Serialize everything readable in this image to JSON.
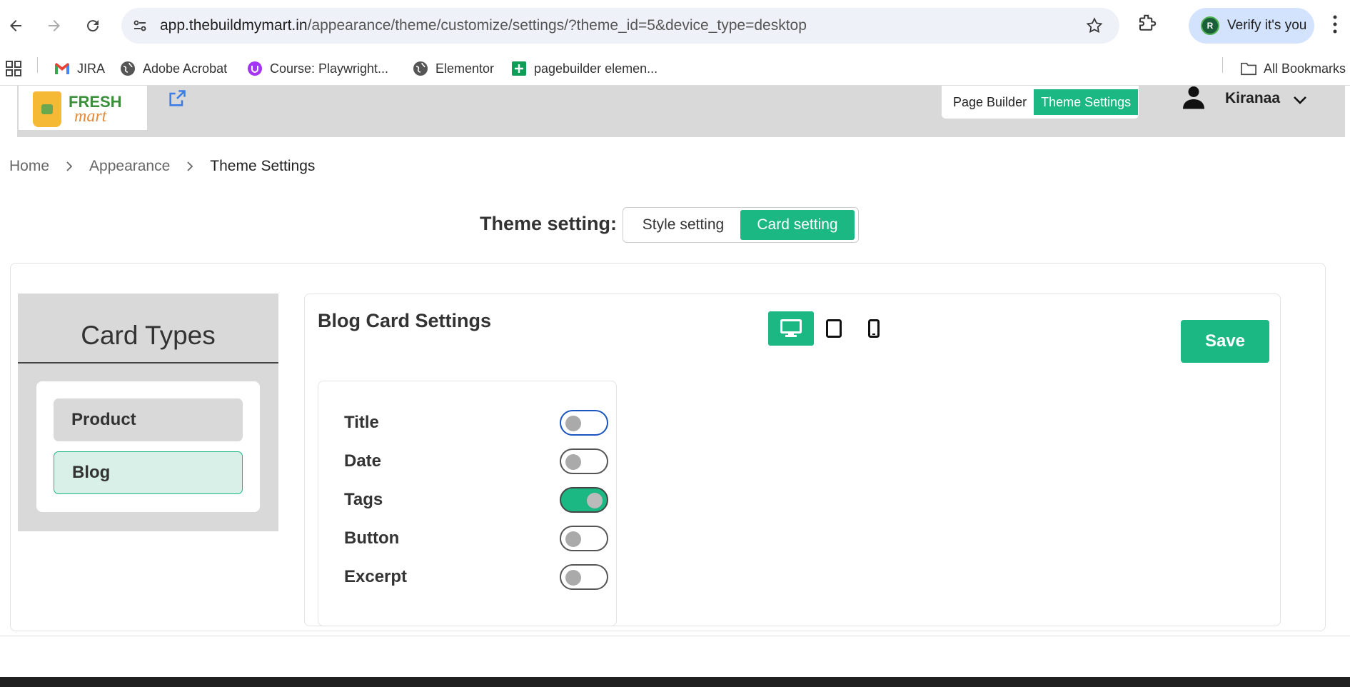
{
  "browser": {
    "url_host": "app.thebuildmymart.in",
    "url_path": "/appearance/theme/customize/settings/?theme_id=5&device_type=desktop",
    "profile_initial": "R",
    "profile_label": "Verify it's you"
  },
  "bookmarks": {
    "items": [
      {
        "label": "JIRA",
        "icon": "gmail-icon"
      },
      {
        "label": "Adobe Acrobat",
        "icon": "globe-icon"
      },
      {
        "label": "Course: Playwright...",
        "icon": "udemy-icon"
      },
      {
        "label": "Elementor",
        "icon": "globe-icon"
      },
      {
        "label": "pagebuilder elemen...",
        "icon": "sheets-icon"
      }
    ],
    "all_bookmarks": "All Bookmarks"
  },
  "header": {
    "logo_fresh": "FRESH",
    "logo_mart": "mart",
    "switcher": [
      "Page Builder",
      "Theme Settings"
    ],
    "active_switch": "Theme Settings",
    "user_name": "Kiranaa"
  },
  "breadcrumb": {
    "items": [
      "Home",
      "Appearance",
      "Theme Settings"
    ]
  },
  "theme": {
    "label": "Theme setting:",
    "options": [
      "Style setting",
      "Card setting"
    ],
    "active": "Card setting"
  },
  "card_types": {
    "title": "Card Types",
    "items": [
      "Product",
      "Blog"
    ],
    "selected": "Blog"
  },
  "settings": {
    "title": "Blog Card Settings",
    "devices": [
      "desktop-icon",
      "tablet-icon",
      "mobile-icon"
    ],
    "active_device": "desktop",
    "save_label": "Save",
    "toggles": [
      {
        "label": "Title",
        "on": false
      },
      {
        "label": "Date",
        "on": false
      },
      {
        "label": "Tags",
        "on": true
      },
      {
        "label": "Button",
        "on": false
      },
      {
        "label": "Excerpt",
        "on": false
      }
    ]
  },
  "colors": {
    "accent": "#1cb883",
    "header_bg": "#d9d9d9",
    "selected_bg": "#d8f0e7"
  }
}
